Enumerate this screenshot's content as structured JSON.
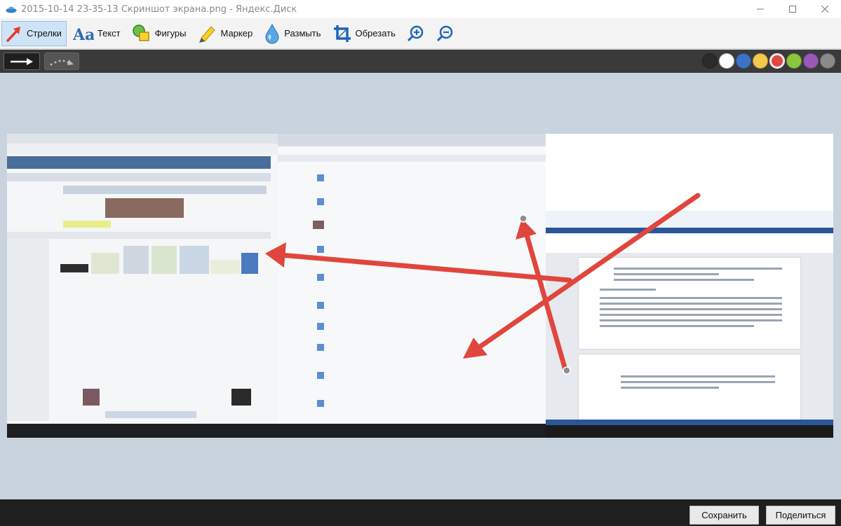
{
  "window": {
    "title": "2015-10-14 23-35-13 Скриншот экрана.png - Яндекс.Диск",
    "controls": [
      "minimize",
      "maximize",
      "close"
    ]
  },
  "toolbar": {
    "tools": [
      {
        "id": "arrows",
        "label": "Стрелки",
        "icon": "arrow-icon",
        "active": true
      },
      {
        "id": "text",
        "label": "Текст",
        "icon": "text-aa-icon",
        "active": false
      },
      {
        "id": "shapes",
        "label": "Фигуры",
        "icon": "shapes-icon",
        "active": false
      },
      {
        "id": "marker",
        "label": "Маркер",
        "icon": "marker-icon",
        "active": false
      },
      {
        "id": "blur",
        "label": "Размыть",
        "icon": "drop-icon",
        "active": false
      },
      {
        "id": "crop",
        "label": "Обрезать",
        "icon": "crop-icon",
        "active": false
      }
    ],
    "zoom_in_icon": "zoom-in-icon",
    "zoom_out_icon": "zoom-out-icon"
  },
  "arrow_styles": [
    {
      "id": "solid",
      "icon": "solid-arrow-icon",
      "selected": true
    },
    {
      "id": "dotted",
      "icon": "dotted-arrow-icon",
      "selected": false
    }
  ],
  "colors": [
    {
      "name": "black",
      "hex": "#2b2b2b"
    },
    {
      "name": "white",
      "hex": "#ffffff"
    },
    {
      "name": "blue",
      "hex": "#3d73c4"
    },
    {
      "name": "yellow",
      "hex": "#f2c94c"
    },
    {
      "name": "red",
      "hex": "#e0463d",
      "selected": true
    },
    {
      "name": "green",
      "hex": "#8cc63f"
    },
    {
      "name": "purple",
      "hex": "#9b59b6"
    },
    {
      "name": "gray",
      "hex": "#8a8a8a"
    }
  ],
  "annotation_color": "#e0463d",
  "footer": {
    "save_label": "Сохранить",
    "share_label": "Поделиться"
  }
}
